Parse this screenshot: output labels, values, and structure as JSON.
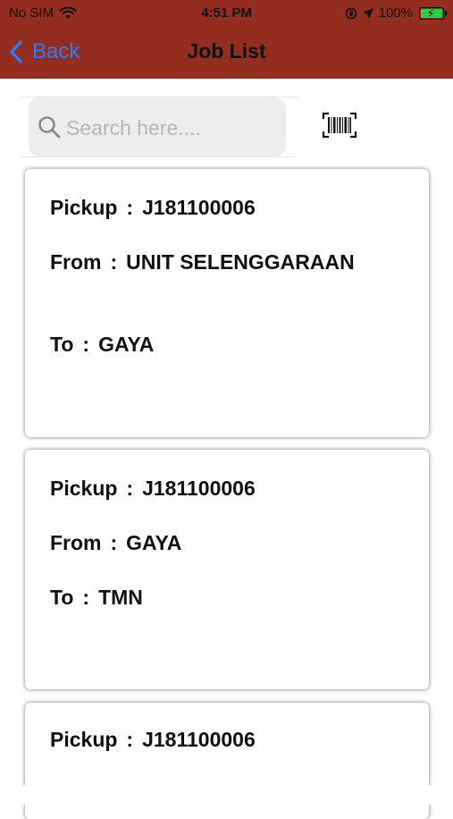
{
  "status_bar": {
    "carrier": "No SIM",
    "time": "4:51 PM",
    "battery": "100%"
  },
  "nav": {
    "back_label": "Back",
    "title": "Job List"
  },
  "search": {
    "placeholder": "Search here...."
  },
  "jobs": [
    {
      "pickup_label": "Pickup",
      "pickup": "J181100006",
      "from_label": "From",
      "from": "UNIT SELENGGARAAN",
      "to_label": "To",
      "to": "GAYA"
    },
    {
      "pickup_label": "Pickup",
      "pickup": "J181100006",
      "from_label": "From",
      "from": "GAYA",
      "to_label": "To",
      "to": "TMN"
    },
    {
      "pickup_label": "Pickup",
      "pickup": "J181100006"
    }
  ],
  "separator": ":",
  "colors": {
    "nav_bar": "#922d1f",
    "back_link": "#2f7bf5",
    "battery": "#2ecc40"
  },
  "icons": [
    "wifi-icon",
    "orientation-lock-icon",
    "location-arrow-icon",
    "battery-icon",
    "chevron-left-icon",
    "search-icon",
    "barcode-icon"
  ]
}
